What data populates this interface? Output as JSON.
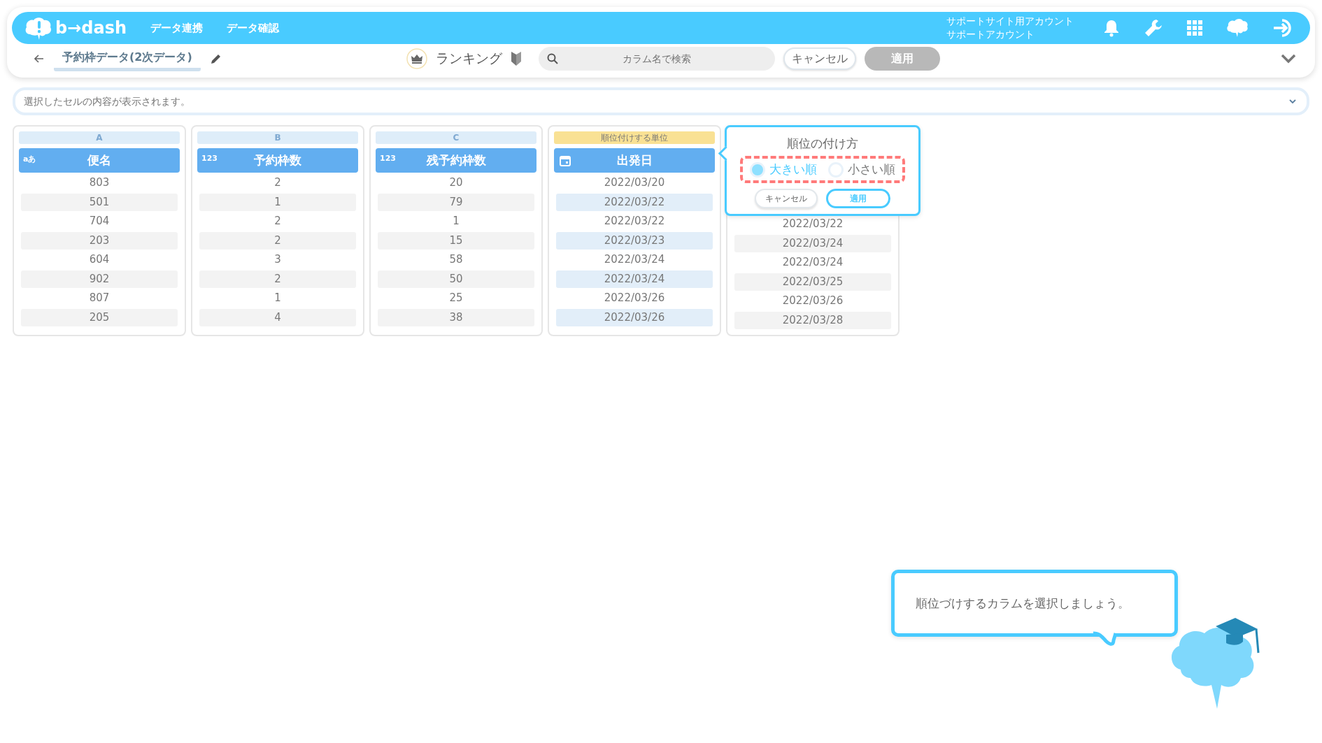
{
  "header": {
    "logo": "b→dash",
    "nav": [
      "データ連携",
      "データ確認"
    ],
    "account": [
      "サポートサイト用アカウント",
      "サポートアカウント"
    ]
  },
  "toolbar": {
    "title": "予約枠データ(2次データ)",
    "mode": "ランキング",
    "search": {
      "placeholder": "カラム名で検索"
    },
    "cancel": "キャンセル",
    "apply": {
      "label": "適用",
      "disabled": true
    }
  },
  "cell_bar": {
    "placeholder": "選択したセルの内容が表示されます。"
  },
  "columns": [
    {
      "letter": "A",
      "kind": "text",
      "type_label": "aあ",
      "name": "便名",
      "selected": false,
      "rows": [
        "803",
        "501",
        "704",
        "203",
        "604",
        "902",
        "807",
        "205"
      ]
    },
    {
      "letter": "B",
      "kind": "number",
      "type_label": "123",
      "name": "予約枠数",
      "selected": false,
      "rows": [
        "2",
        "1",
        "2",
        "2",
        "3",
        "2",
        "1",
        "4"
      ]
    },
    {
      "letter": "C",
      "kind": "number",
      "type_label": "123",
      "name": "残予約枠数",
      "selected": false,
      "rows": [
        "20",
        "79",
        "1",
        "15",
        "58",
        "50",
        "25",
        "38"
      ]
    },
    {
      "unit_label": "順位付けする単位",
      "kind": "date",
      "name": "出発日",
      "selected": true,
      "rows": [
        "2022/03/20",
        "2022/03/22",
        "2022/03/22",
        "2022/03/23",
        "2022/03/24",
        "2022/03/24",
        "2022/03/26",
        "2022/03/26"
      ]
    },
    {
      "selected": false,
      "rows": [
        "2022/03/22",
        "2022/03/24",
        "2022/03/24",
        "2022/03/25",
        "2022/03/26",
        "2022/03/28"
      ]
    }
  ],
  "popover": {
    "title": "順位の付け方",
    "options": [
      {
        "label": "大きい順",
        "selected": true
      },
      {
        "label": "小さい順",
        "selected": false
      }
    ],
    "cancel": "キャンセル",
    "apply": "適用"
  },
  "hint": {
    "text": "順位づけするカラムを選択しましょう。"
  }
}
